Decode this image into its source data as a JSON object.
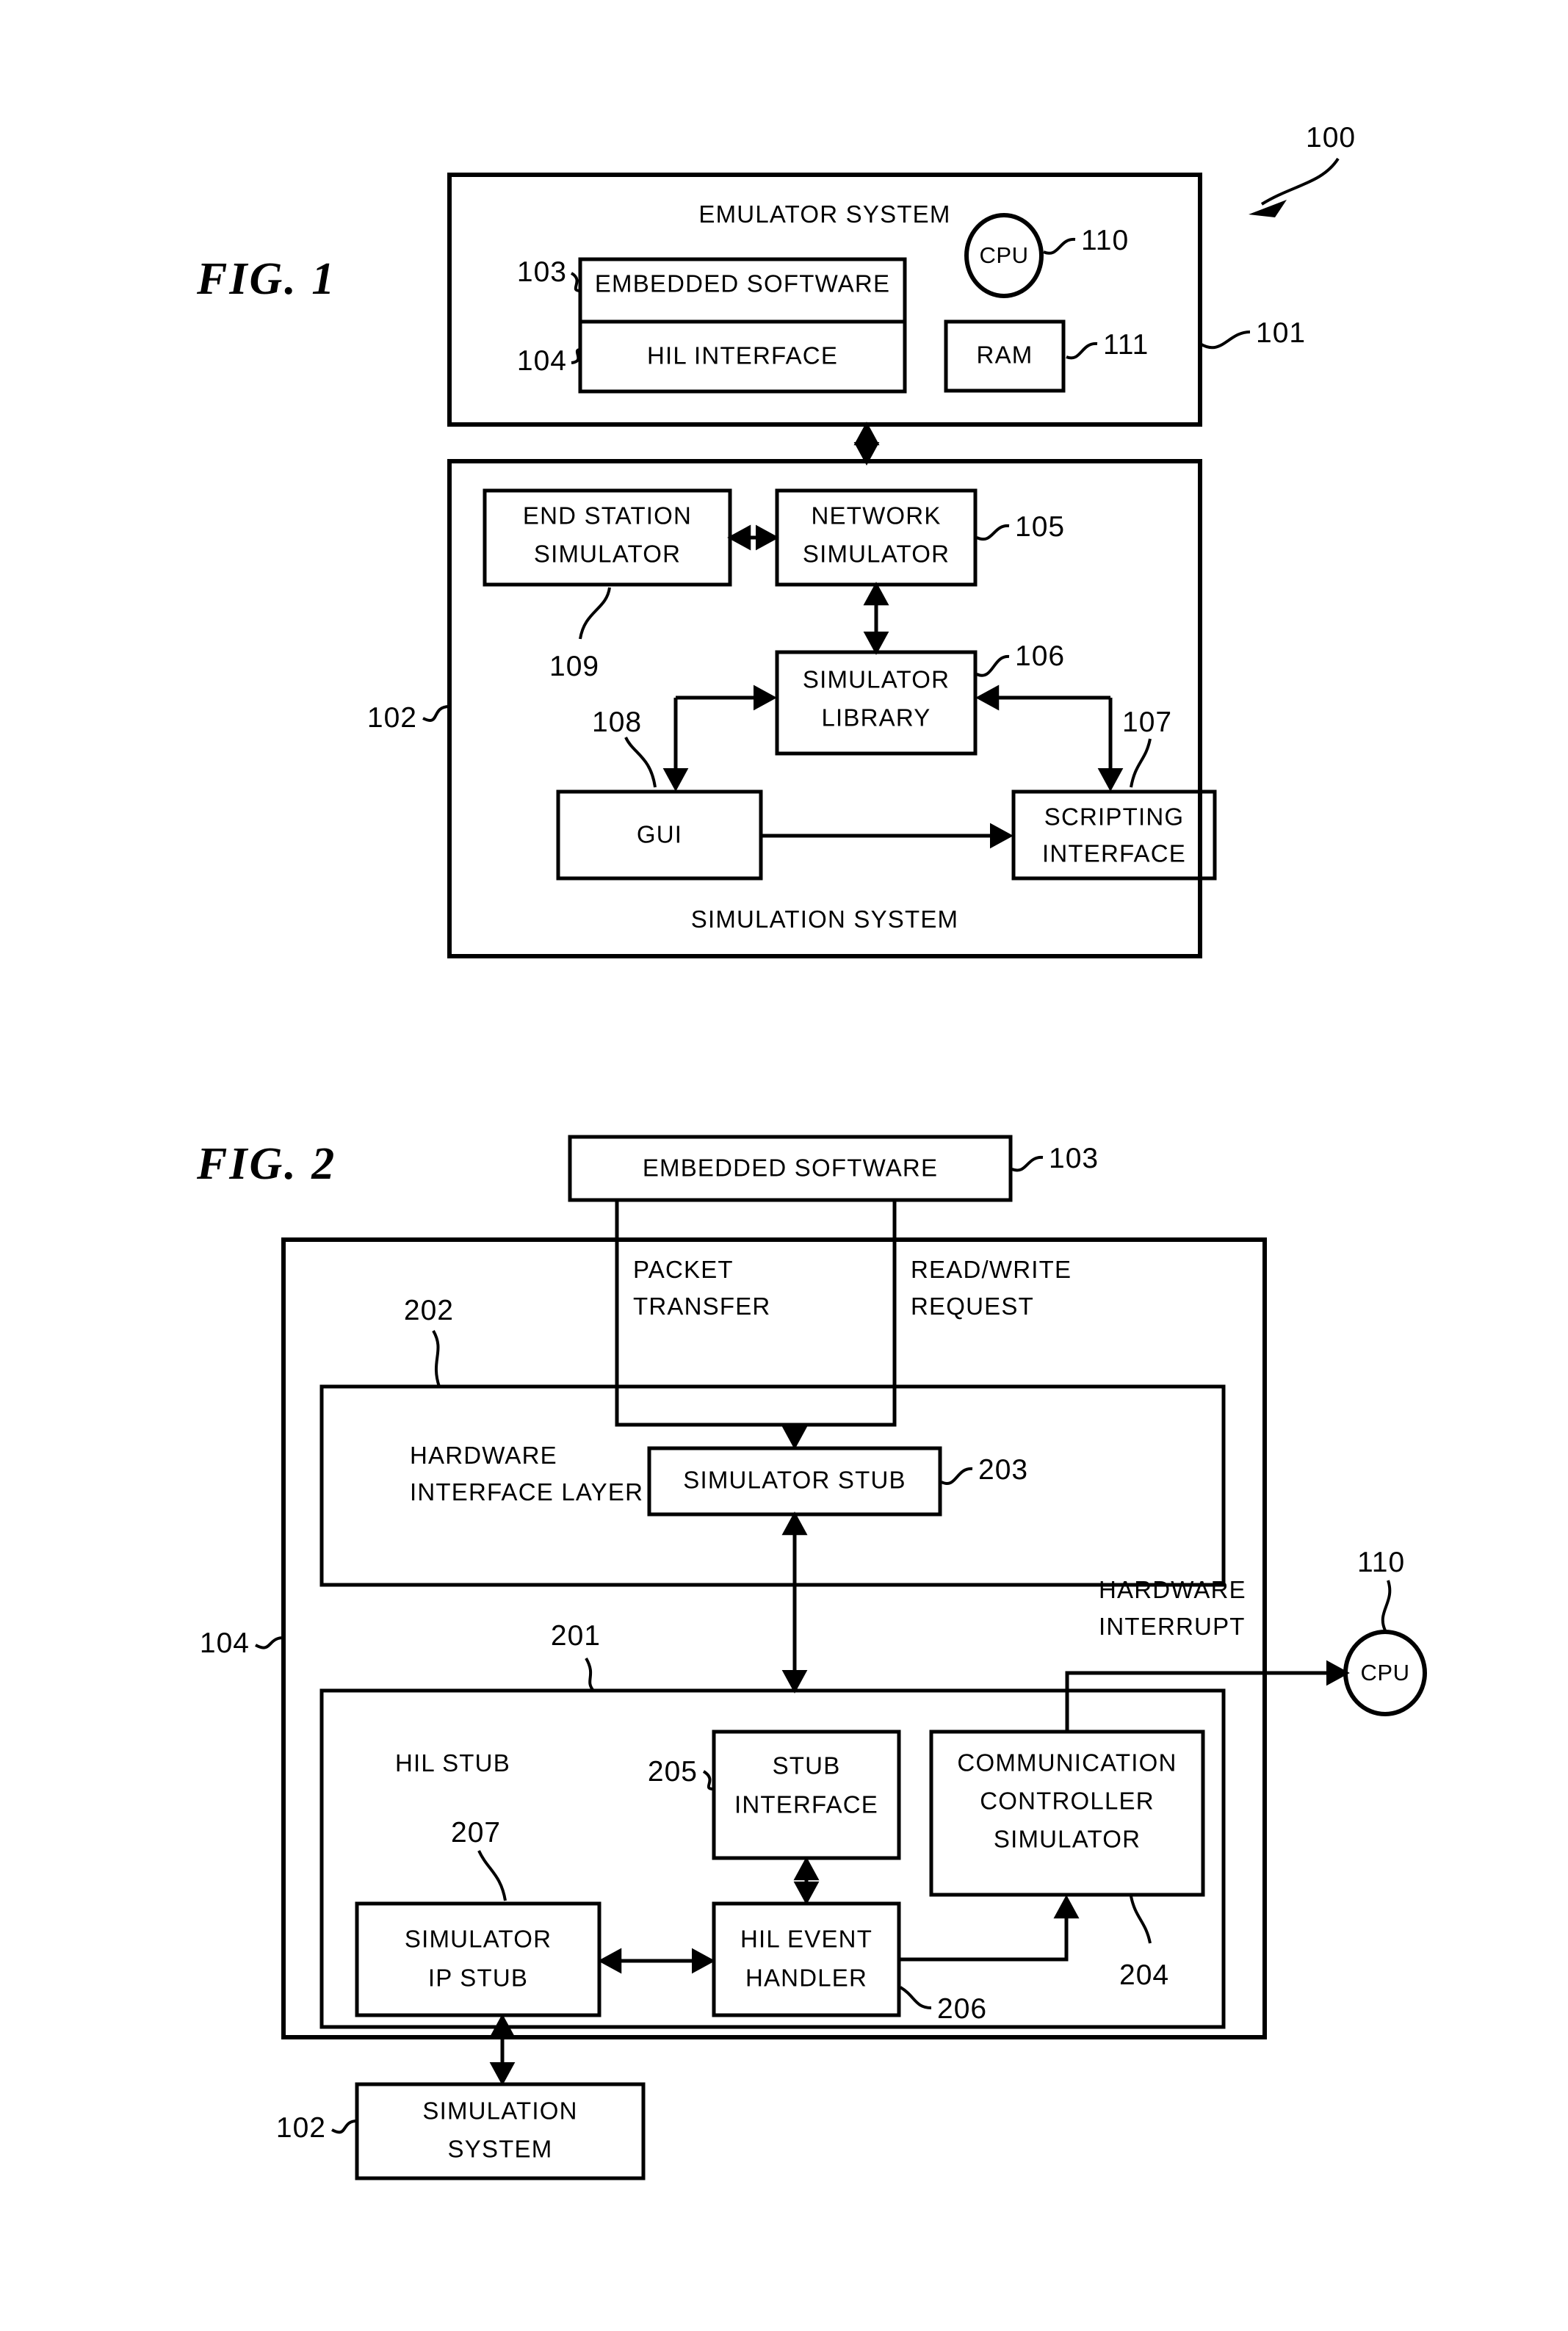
{
  "sheet": {
    "background": "#ffffff",
    "ink": "#000000"
  },
  "figures": [
    {
      "id": "fig1",
      "label": "FIG.  1",
      "top_reference": "100",
      "boxes": {
        "emulator_system": {
          "title": "EMULATOR SYSTEM",
          "reference": "101",
          "children": [
            {
              "label": "EMBEDDED SOFTWARE",
              "reference": "103"
            },
            {
              "label": "HIL INTERFACE",
              "reference": "104"
            },
            {
              "label": "CPU",
              "reference": "110"
            },
            {
              "label": "RAM",
              "reference": "111"
            }
          ]
        },
        "simulation_system": {
          "title": "SIMULATION SYSTEM",
          "reference": "102",
          "children": [
            {
              "label": "END STATION SIMULATOR",
              "line1": "END STATION",
              "line2": "SIMULATOR",
              "reference": "109"
            },
            {
              "label": "NETWORK SIMULATOR",
              "line1": "NETWORK",
              "line2": "SIMULATOR",
              "reference": "105"
            },
            {
              "label": "SIMULATOR LIBRARY",
              "line1": "SIMULATOR",
              "line2": "LIBRARY",
              "reference": "106"
            },
            {
              "label": "GUI",
              "line1": "GUI",
              "line2": "",
              "reference": "108"
            },
            {
              "label": "SCRIPTING INTERFACE",
              "line1": "SCRIPTING",
              "line2": "INTERFACE",
              "reference": "107"
            }
          ]
        }
      }
    },
    {
      "id": "fig2",
      "label": "FIG.  2",
      "boxes": {
        "embedded_software": {
          "label": "EMBEDDED SOFTWARE",
          "reference": "103"
        },
        "hil_interface": {
          "reference": "104"
        },
        "hardware_interface_layer": {
          "line1": "HARDWARE",
          "line2": "INTERFACE LAYER",
          "reference": "202",
          "children": [
            {
              "label": "SIMULATOR STUB",
              "reference": "203"
            }
          ]
        },
        "hil_stub": {
          "label": "HIL STUB",
          "reference": "201",
          "children": [
            {
              "label": "STUB INTERFACE",
              "line1": "STUB",
              "line2": "INTERFACE",
              "reference": "205"
            },
            {
              "label": "COMMUNICATION CONTROLLER SIMULATOR",
              "line1": "COMMUNICATION",
              "line2": "CONTROLLER",
              "line3": "SIMULATOR",
              "reference": "204"
            },
            {
              "label": "SIMULATOR IP STUB",
              "line1": "SIMULATOR",
              "line2": "IP STUB",
              "reference": "207"
            },
            {
              "label": "HIL EVENT HANDLER",
              "line1": "HIL EVENT",
              "line2": "HANDLER",
              "reference": "206"
            }
          ]
        },
        "simulation_system": {
          "line1": "SIMULATION",
          "line2": "SYSTEM",
          "reference": "102"
        },
        "cpu": {
          "label": "CPU",
          "reference": "110"
        }
      },
      "flow_labels": [
        {
          "line1": "PACKET",
          "line2": "TRANSFER"
        },
        {
          "line1": "READ/WRITE",
          "line2": "REQUEST"
        },
        {
          "line1": "HARDWARE",
          "line2": "INTERRUPT"
        }
      ]
    }
  ]
}
